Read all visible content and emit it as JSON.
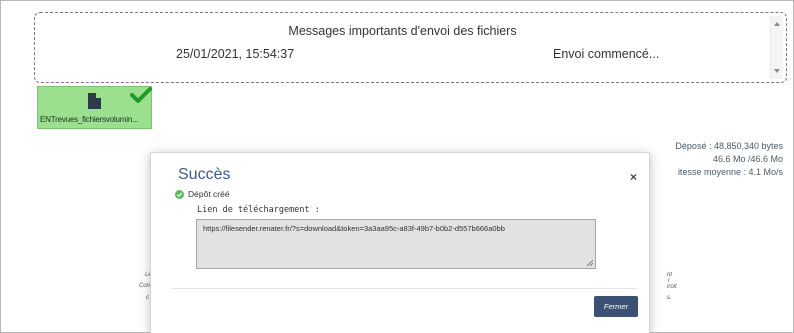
{
  "messages": {
    "title": "Messages importants d'envoi des fichiers",
    "date": "25/01/2021, 15:54:37",
    "status": "Envoi commencé..."
  },
  "file": {
    "name": "ENTrevues_fichiersvolumin...",
    "icon": "file-icon",
    "status_icon": "check-icon",
    "tile_color": "#9be08f"
  },
  "stats": {
    "deposited": "Déposé : 48,850,340 bytes",
    "size": "46.6 Mo /46.6 Mo",
    "speed": "itesse moyenne : 4.1 Mo/s"
  },
  "background_fragments": {
    "left": [
      "Le",
      "Con",
      "c"
    ],
    "right": [
      "nt",
      "i",
      "iroit",
      "s."
    ]
  },
  "modal": {
    "title": "Succès",
    "close_glyph": "×",
    "status": "Dépôt créé",
    "link_label": "Lien de téléchargement :",
    "link_value": "https://filesender.renater.fr/?s=download&token=3a3aa95c-a83f-49b7-b0b2-d557b666a0bb",
    "close_button": "Fermer",
    "accent": "#3c5a8c",
    "button_color": "#3b5174"
  }
}
